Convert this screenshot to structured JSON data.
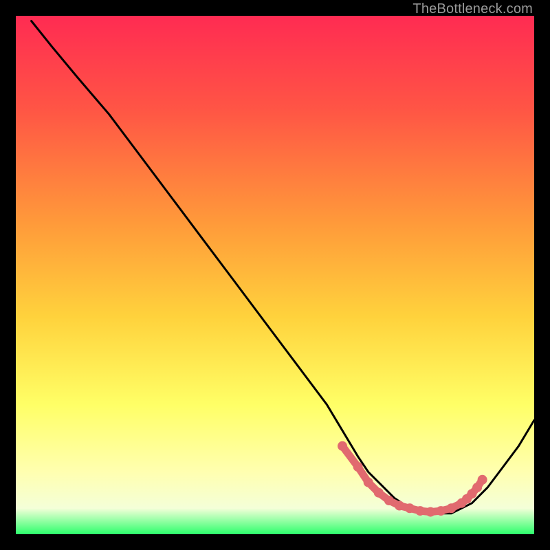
{
  "watermark": "TheBottleneck.com",
  "colors": {
    "gradient_top": "#ff2b52",
    "gradient_mid1": "#ff6a3f",
    "gradient_mid2": "#ffc93c",
    "gradient_mid3": "#ffff66",
    "gradient_mid4": "#ffffc0",
    "gradient_bottom": "#2dff6c",
    "curve": "#000000",
    "highlight": "#e16a6f",
    "frame": "#000000"
  },
  "chart_data": {
    "type": "line",
    "title": "",
    "xlabel": "",
    "ylabel": "",
    "xlim": [
      0,
      100
    ],
    "ylim": [
      0,
      100
    ],
    "series": [
      {
        "name": "bottleneck-curve",
        "x": [
          3,
          7,
          12,
          18,
          24,
          30,
          36,
          42,
          48,
          54,
          60,
          63,
          66,
          68,
          71,
          73,
          76,
          79,
          81,
          84,
          86,
          88,
          91,
          94,
          97,
          100
        ],
        "y": [
          99,
          94,
          88,
          81,
          73,
          65,
          57,
          49,
          41,
          33,
          25,
          20,
          15,
          12,
          9,
          7,
          5,
          4,
          4,
          4,
          5,
          6,
          9,
          13,
          17,
          22
        ]
      }
    ],
    "highlight_segment": {
      "name": "optimal-range",
      "x": [
        63,
        66,
        68,
        70,
        72,
        74,
        76,
        78,
        80,
        82,
        84,
        86,
        87,
        88,
        89,
        90
      ],
      "y": [
        17,
        13,
        10,
        8,
        6.5,
        5.5,
        5,
        4.5,
        4.3,
        4.5,
        5,
        6,
        6.8,
        7.8,
        9,
        10.5
      ]
    }
  }
}
